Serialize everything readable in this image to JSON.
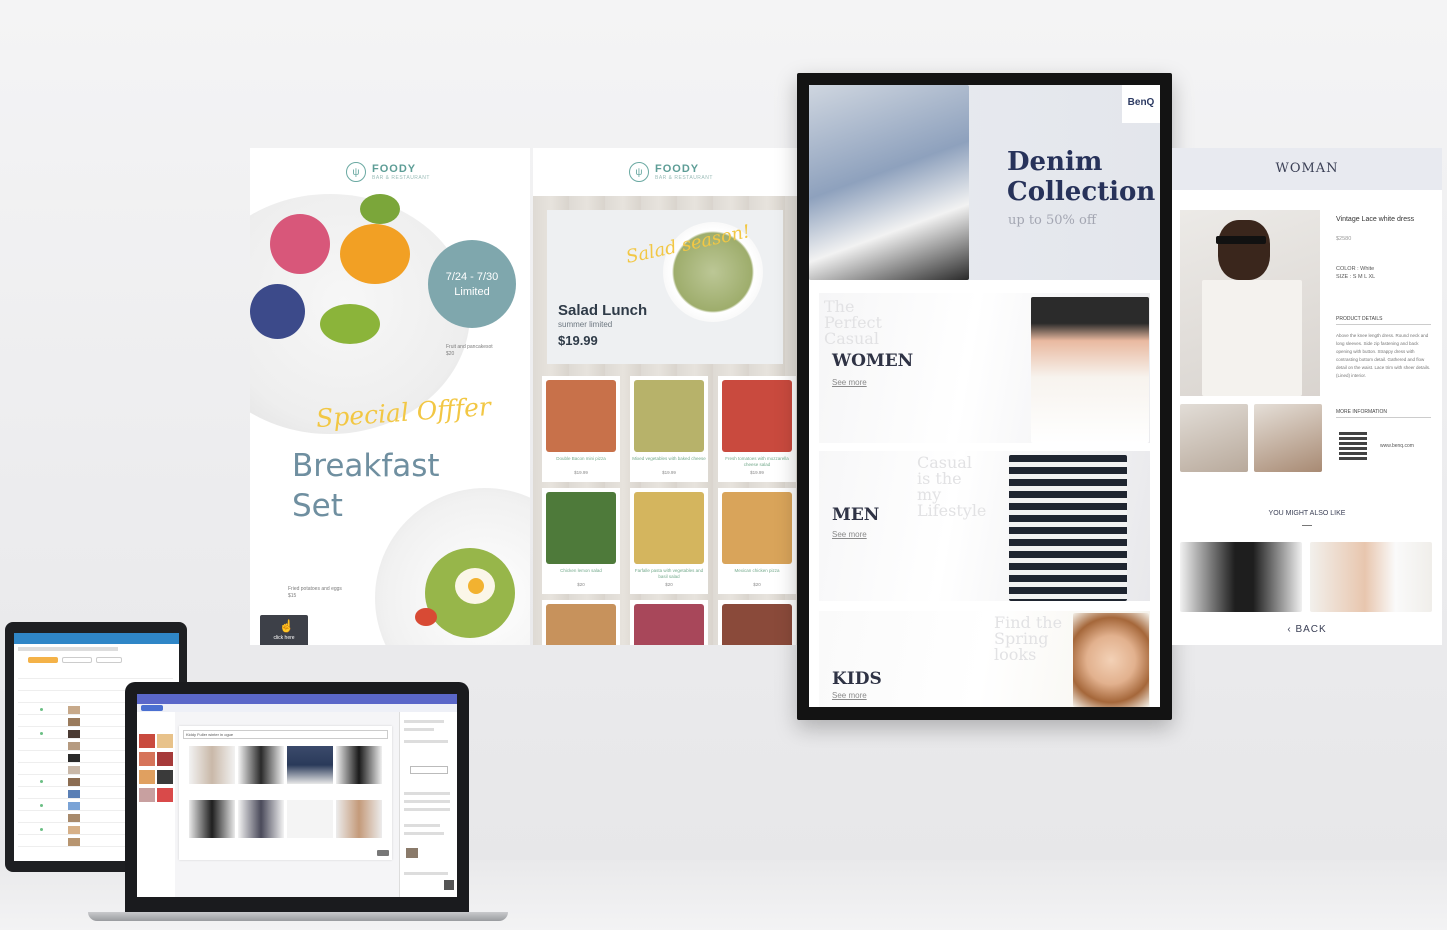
{
  "restaurant": {
    "brand": "FOODY",
    "tagline": "BAR & RESTAURANT",
    "badge_dates": "7/24 - 7/30",
    "badge_limited": "Limited",
    "fruit_note": "Fruit and pancakesot",
    "fruit_price": "$20",
    "special": "Special Offfer",
    "breakfast_line1": "Breakfast",
    "breakfast_line2": "Set",
    "potato_note": "Fried potatoes and eggs",
    "potato_price": "$15",
    "touch_label": "click here"
  },
  "menu": {
    "brand": "FOODY",
    "tagline": "BAR & RESTAURANT",
    "script": "Salad season!",
    "title": "Salad Lunch",
    "subtitle": "summer limited",
    "price": "$19.99",
    "tiles": [
      {
        "caption": "Double Bacon mini pizza",
        "price": "$19.99",
        "color": "#c8714a"
      },
      {
        "caption": "Mixed vegetables with baked cheese",
        "price": "$19.99",
        "color": "#b7b26a"
      },
      {
        "caption": "Fresh tomatoes with mozzarella cheese salad",
        "price": "$19.99",
        "color": "#c94a3e"
      },
      {
        "caption": "Chicken lemon salad",
        "price": "$20",
        "color": "#4e7a3a"
      },
      {
        "caption": "Farfalle pasta with vegetables and basil salad",
        "price": "$20",
        "color": "#d4b55e"
      },
      {
        "caption": "Mexican chicken pizza",
        "price": "$20",
        "color": "#d9a45a"
      },
      {
        "caption": "",
        "price": "",
        "color": "#c7925c"
      },
      {
        "caption": "",
        "price": "",
        "color": "#a8475a"
      },
      {
        "caption": "",
        "price": "",
        "color": "#8a4a3a"
      }
    ]
  },
  "fashion": {
    "brand": "BenQ",
    "hero_line1": "Denim",
    "hero_line2": "Collection",
    "hero_sub": "up to 50% off",
    "categories": [
      {
        "label": "WOMEN",
        "more": "See more",
        "ghost": "The Perfect Casual"
      },
      {
        "label": "MEN",
        "more": "See more",
        "ghost": "Casual is the my Lifestyle"
      },
      {
        "label": "KIDS",
        "more": "See more",
        "ghost": "Find the Spring looks"
      }
    ]
  },
  "woman": {
    "title": "WOMAN",
    "product": "Vintage Lace white dress",
    "price": "$2580",
    "color": "COLOR : White",
    "size": "SIZE : S M L XL",
    "details_head": "PRODUCT DETAILS",
    "details_text": "Above the knee length dress. Round neck and long sleeves. Side zip fastening and back opening with button. Strappy dress with contrasting bottom detail. Gathered and flow detail on the waist. Lace trim with sheer details. (Lined) interior.",
    "info_head": "MORE INFORMATION",
    "site": "www.benq.com",
    "also_like": "YOU MIGHT ALSO LIKE",
    "back": "BACK"
  },
  "cms": {
    "search_value": "Kiddy Fuller winter in ogue"
  }
}
